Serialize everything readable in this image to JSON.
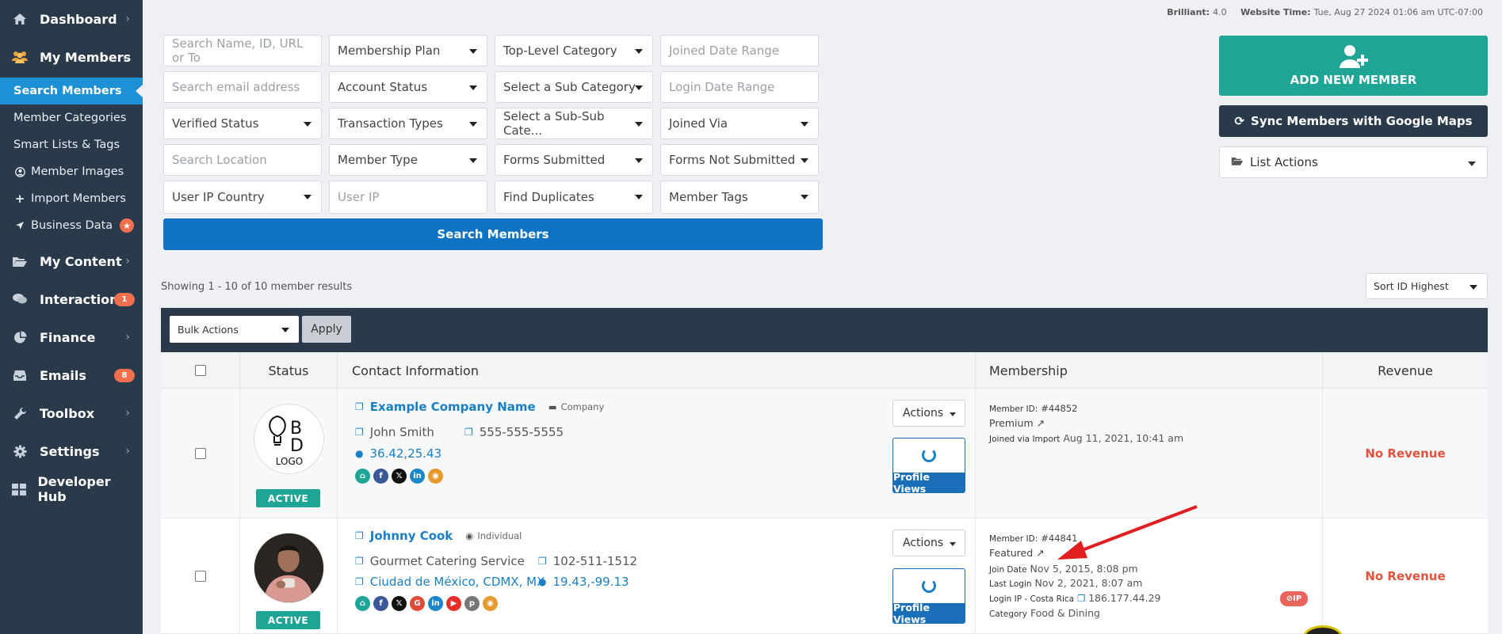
{
  "topinfo": {
    "brilliant_label": "Brilliant:",
    "brilliant_value": "4.0",
    "time_label": "Website Time:",
    "time_value": "Tue, Aug 27 2024 01:06 am UTC-07:00"
  },
  "sidebar": {
    "dashboard": "Dashboard",
    "my_members": "My Members",
    "sub": {
      "search": "Search Members",
      "categories": "Member Categories",
      "smart": "Smart Lists & Tags",
      "images": "Member Images",
      "import": "Import Members",
      "business": "Business Data"
    },
    "my_content": "My Content",
    "interactions": "Interactions",
    "interactions_badge": "1",
    "finance": "Finance",
    "emails": "Emails",
    "emails_badge": "8",
    "toolbox": "Toolbox",
    "settings": "Settings",
    "developer": "Developer Hub"
  },
  "filters": {
    "search_name_ph": "Search Name, ID, URL or To",
    "membership_plan": "Membership Plan",
    "top_category": "Top-Level Category",
    "joined_range_ph": "Joined Date Range",
    "email_ph": "Search email address",
    "account_status": "Account Status",
    "sub_category": "Select a Sub Category",
    "login_range_ph": "Login Date Range",
    "verified": "Verified Status",
    "transaction": "Transaction Types",
    "subsub_category": "Select a Sub-Sub Cate...",
    "joined_via": "Joined Via",
    "location_ph": "Search Location",
    "member_type": "Member Type",
    "forms_submitted": "Forms Submitted",
    "forms_not": "Forms Not Submitted",
    "ip_country": "User IP Country",
    "user_ip_ph": "User IP",
    "duplicates": "Find Duplicates",
    "member_tags": "Member Tags",
    "search_btn": "Search Members"
  },
  "right": {
    "add": "ADD NEW MEMBER",
    "sync": "Sync Members with Google Maps",
    "list_actions": "List Actions"
  },
  "results": {
    "showing": "Showing 1 - 10 of 10 member results",
    "sort": "Sort ID Highest"
  },
  "bulk": {
    "select": "Bulk Actions",
    "apply": "Apply"
  },
  "table": {
    "headers": {
      "status": "Status",
      "contact": "Contact Information",
      "membership": "Membership",
      "revenue": "Revenue"
    },
    "rows": [
      {
        "status": "ACTIVE",
        "logo_text": "LOGO",
        "name": "Example Company Name",
        "type": "Company",
        "contact_name": "John Smith",
        "phone": "555-555-5555",
        "coords": "36.42,25.43",
        "actions": "Actions",
        "profile_views": "Profile Views",
        "member_id_label": "Member ID:",
        "member_id": "#44852",
        "plan": "Premium",
        "joined_label": "Joined via Import",
        "joined": "Aug 11, 2021, 10:41 am",
        "revenue": "No Revenue"
      },
      {
        "status": "ACTIVE",
        "name": "Johnny Cook",
        "type": "Individual",
        "company": "Gourmet Catering Service",
        "phone": "102-511-1512",
        "location": "Ciudad de México, CDMX, MX",
        "coords": "19.43,-99.13",
        "actions": "Actions",
        "profile_views": "Profile Views",
        "member_id_label": "Member ID:",
        "member_id": "#44841",
        "plan": "Featured",
        "join_label": "Join Date",
        "join_date": "Nov 5, 2015, 8:08 pm",
        "login_label": "Last Login",
        "login_date": "Nov 2, 2021, 8:07 am",
        "ip_label": "Login IP - Costa Rica",
        "ip": "186.177.44.29",
        "ip_badge": "IP",
        "category_label": "Category",
        "category": "Food & Dining",
        "revenue": "No Revenue"
      }
    ]
  },
  "colors": {
    "sidebar": "#2a3a4b",
    "active_nav": "#1e90d6",
    "teal": "#1fa595",
    "blue": "#0d73c2",
    "danger": "#e0533f",
    "arrow": "#e02020"
  }
}
